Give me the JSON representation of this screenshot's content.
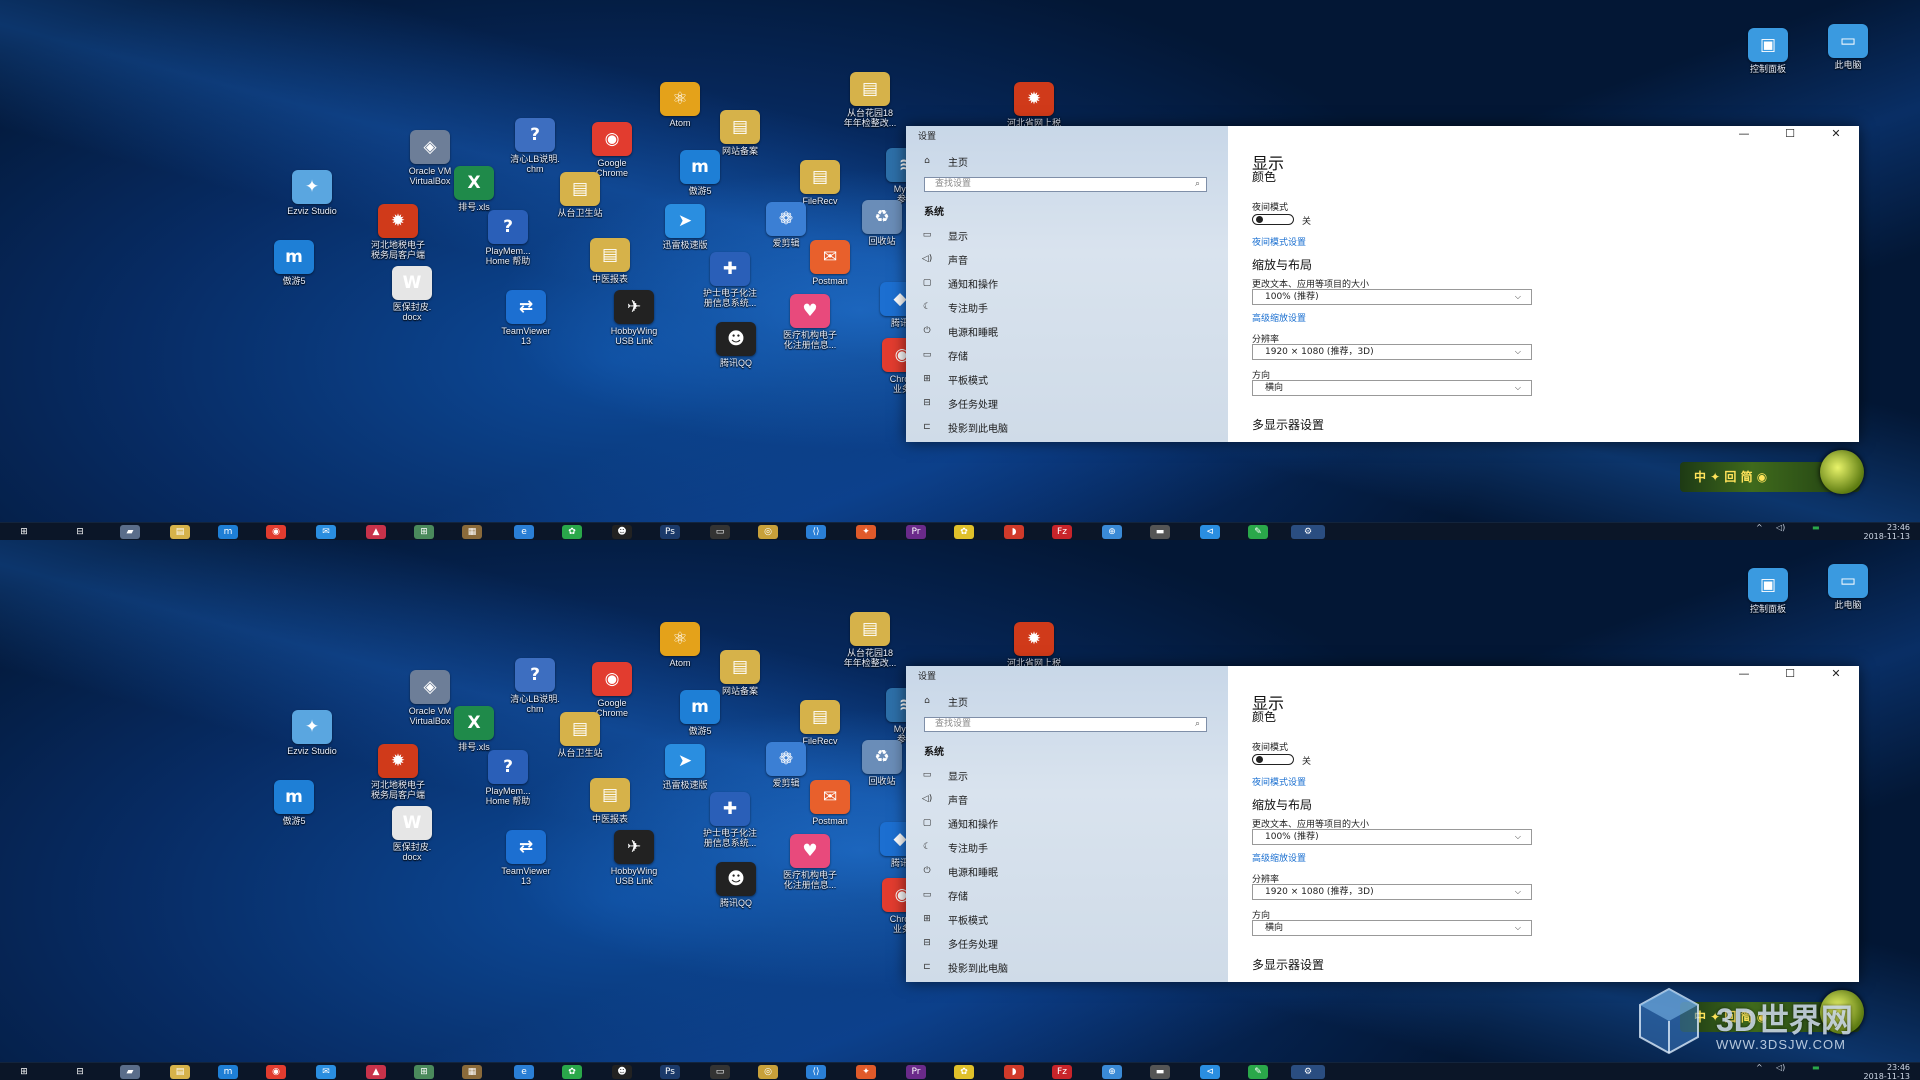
{
  "desktop_icons": [
    {
      "label": "Atom",
      "icon": "atom-icon",
      "color": "#e4a21a",
      "glyph": "⚛"
    },
    {
      "label": "从台花园18\n年年检整改...",
      "icon": "folder-icon",
      "color": "#d6b24a",
      "glyph": "▤"
    },
    {
      "label": "河北省网上税\n务局",
      "icon": "tax-bureau-icon",
      "color": "#d03a1a",
      "glyph": "✹"
    },
    {
      "label": "网站备案",
      "icon": "folder-icon",
      "color": "#d6b24a",
      "glyph": "▤"
    },
    {
      "label": "Oracle VM\nVirtualBox",
      "icon": "virtualbox-icon",
      "color": "#6d7e98",
      "glyph": "◈"
    },
    {
      "label": "清心LB说明.\nchm",
      "icon": "help-file-icon",
      "color": "#3d6ec0",
      "glyph": "?"
    },
    {
      "label": "Google\nChrome",
      "icon": "chrome-icon",
      "color": "#e23c2f",
      "glyph": "◉"
    },
    {
      "label": "傲游5",
      "icon": "maxthon-icon",
      "color": "#1e7fd6",
      "glyph": "m"
    },
    {
      "label": "FileRecv",
      "icon": "folder-icon",
      "color": "#d6b24a",
      "glyph": "▤"
    },
    {
      "label": "MySC\n参考",
      "icon": "mysql-icon",
      "color": "#2d6fa8",
      "glyph": "≋"
    },
    {
      "label": "Ezviz Studio",
      "icon": "ezviz-icon",
      "color": "#5aa6e0",
      "glyph": "✦"
    },
    {
      "label": "排号.xls",
      "icon": "excel-icon",
      "color": "#1f8a4a",
      "glyph": "X"
    },
    {
      "label": "从台卫生站",
      "icon": "folder-icon",
      "color": "#d6b24a",
      "glyph": "▤"
    },
    {
      "label": "河北地税电子\n税务局客户端",
      "icon": "tax-client-icon",
      "color": "#d03a1a",
      "glyph": "✹"
    },
    {
      "label": "PlayMem...\nHome 帮助",
      "icon": "help-icon",
      "color": "#2a5fb8",
      "glyph": "?"
    },
    {
      "label": "迅雷极速版",
      "icon": "thunder-icon",
      "color": "#2a8ee0",
      "glyph": "➤"
    },
    {
      "label": "爱剪辑",
      "icon": "video-editor-icon",
      "color": "#3b7fd4",
      "glyph": "❁"
    },
    {
      "label": "回收站",
      "icon": "recycle-bin-icon",
      "color": "#6a8db8",
      "glyph": "♻"
    },
    {
      "label": "傲游5",
      "icon": "maxthon-icon",
      "color": "#1e7fd6",
      "glyph": "m"
    },
    {
      "label": "中医报表",
      "icon": "folder-icon",
      "color": "#d6b24a",
      "glyph": "▤"
    },
    {
      "label": "护士电子化注\n册信息系统...",
      "icon": "nurse-system-icon",
      "color": "#2a5fb8",
      "glyph": "✚"
    },
    {
      "label": "Postman",
      "icon": "postman-icon",
      "color": "#e8602c",
      "glyph": "✉"
    },
    {
      "label": "医保封皮.\ndocx",
      "icon": "word-icon",
      "color": "#e6e6e6",
      "glyph": "W"
    },
    {
      "label": "TeamViewer\n13",
      "icon": "teamviewer-icon",
      "color": "#1c6fd1",
      "glyph": "⇄"
    },
    {
      "label": "HobbyWing\nUSB Link",
      "icon": "hobbywing-icon",
      "color": "#222222",
      "glyph": "✈"
    },
    {
      "label": "医疗机构电子\n化注册信息...",
      "icon": "medical-system-icon",
      "color": "#e84a7c",
      "glyph": "♥"
    },
    {
      "label": "腾讯",
      "icon": "tencent-icon",
      "color": "#1c6fd1",
      "glyph": "◆"
    },
    {
      "label": "腾讯QQ",
      "icon": "qq-icon",
      "color": "#222222",
      "glyph": "☻"
    },
    {
      "label": "Chron\n业务",
      "icon": "chrome-icon",
      "color": "#e23c2f",
      "glyph": "◉"
    },
    {
      "label": "控制面板",
      "icon": "control-panel-icon",
      "color": "#3a9ae0",
      "glyph": "▣"
    },
    {
      "label": "此电脑",
      "icon": "this-pc-icon",
      "color": "#3a9ae0",
      "glyph": "▭"
    }
  ],
  "deco_widget": {
    "text": "中 ✦ 回 简 ◉"
  },
  "settings": {
    "window_title": "设置",
    "window_controls": {
      "minimize": "—",
      "maximize": "☐",
      "close": "✕"
    },
    "home_label": "主页",
    "search_placeholder": "查找设置",
    "category": "系统",
    "nav": [
      {
        "label": "显示",
        "icon": "display-icon",
        "glyph": "▭"
      },
      {
        "label": "声音",
        "icon": "sound-icon",
        "glyph": "◁)"
      },
      {
        "label": "通知和操作",
        "icon": "notification-icon",
        "glyph": "▢"
      },
      {
        "label": "专注助手",
        "icon": "focus-assist-icon",
        "glyph": "☾"
      },
      {
        "label": "电源和睡眠",
        "icon": "power-icon",
        "glyph": "⏻"
      },
      {
        "label": "存储",
        "icon": "storage-icon",
        "glyph": "▭"
      },
      {
        "label": "平板模式",
        "icon": "tablet-mode-icon",
        "glyph": "⊞"
      },
      {
        "label": "多任务处理",
        "icon": "multitasking-icon",
        "glyph": "⊟"
      },
      {
        "label": "投影到此电脑",
        "icon": "project-icon",
        "glyph": "⊏"
      }
    ],
    "page_title": "显示",
    "color_heading": "颜色",
    "night_light_label": "夜间模式",
    "night_light_state": "关",
    "night_light_link": "夜间模式设置",
    "scale_heading": "缩放与布局",
    "scale_label": "更改文本、应用等项目的大小",
    "scale_value": "100% (推荐)",
    "advanced_scaling_link": "高级缩放设置",
    "resolution_label": "分辨率",
    "resolution_value": "1920 × 1080 (推荐，3D)",
    "orientation_label": "方向",
    "orientation_value": "横向",
    "multi_display_heading": "多显示器设置"
  },
  "taskbar": {
    "start_icon": "⊞",
    "apps": [
      {
        "icon": "task-view-icon",
        "glyph": "⊟",
        "color": "#0b1628"
      },
      {
        "icon": "device-icon",
        "glyph": "▰",
        "color": "#5a6d8a"
      },
      {
        "icon": "file-explorer-icon",
        "glyph": "▤",
        "color": "#d6b24a"
      },
      {
        "icon": "maxthon-icon",
        "glyph": "m",
        "color": "#1e7fd6"
      },
      {
        "icon": "chrome-icon",
        "glyph": "◉",
        "color": "#e23c2f"
      },
      {
        "icon": "mail-icon",
        "glyph": "✉",
        "color": "#2a8ee0"
      },
      {
        "icon": "car-icon",
        "glyph": "▲",
        "color": "#c8324a"
      },
      {
        "icon": "network-icon",
        "glyph": "⊞",
        "color": "#4a8a5c"
      },
      {
        "icon": "media-icon",
        "glyph": "▦",
        "color": "#8a6a3a"
      },
      {
        "icon": "browser-icon",
        "glyph": "e",
        "color": "#2a7fd6"
      },
      {
        "icon": "wechat-icon",
        "glyph": "✿",
        "color": "#2aa84a"
      },
      {
        "icon": "qq-icon",
        "glyph": "☻",
        "color": "#222222"
      },
      {
        "icon": "photoshop-icon",
        "glyph": "Ps",
        "color": "#1b3a6a"
      },
      {
        "icon": "terminal-icon",
        "glyph": "▭",
        "color": "#333333"
      },
      {
        "icon": "disc-icon",
        "glyph": "◎",
        "color": "#c8a03a"
      },
      {
        "icon": "vs-code-icon",
        "glyph": "⟨⟩",
        "color": "#2a7fd6"
      },
      {
        "icon": "chat-icon",
        "glyph": "✦",
        "color": "#e05a2a"
      },
      {
        "icon": "premiere-icon",
        "glyph": "Pr",
        "color": "#6a2a8a"
      },
      {
        "icon": "duck-icon",
        "glyph": "✿",
        "color": "#e0c02a"
      },
      {
        "icon": "mango-icon",
        "glyph": "◗",
        "color": "#d03a2a"
      },
      {
        "icon": "filezilla-icon",
        "glyph": "Fz",
        "color": "#c8242a"
      },
      {
        "icon": "network-drive-icon",
        "glyph": "⊕",
        "color": "#3a8ad6"
      },
      {
        "icon": "console-icon",
        "glyph": "▬",
        "color": "#555555"
      },
      {
        "icon": "vs-icon",
        "glyph": "⊲",
        "color": "#2a8ee0"
      },
      {
        "icon": "paint-icon",
        "glyph": "✎",
        "color": "#2aa84a"
      },
      {
        "icon": "settings-icon",
        "glyph": "⚙",
        "color": "#2a4d80"
      }
    ],
    "tray": {
      "chevron": "^",
      "volume": "◁)",
      "battery": "▬"
    },
    "time": "23:46",
    "date": "2018-11-13"
  },
  "watermark": {
    "title": "3D世界网",
    "url": "WWW.3DSJW.COM"
  }
}
